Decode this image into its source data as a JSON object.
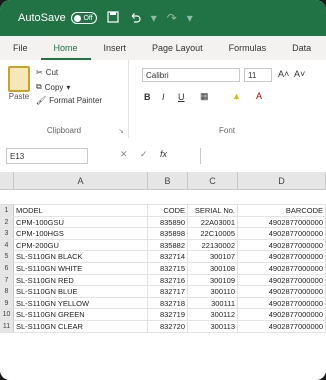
{
  "titlebar": {
    "autosave_label": "AutoSave",
    "autosave_state": "Off",
    "save_icon": "save-icon",
    "undo_icon": "undo-icon",
    "redo_icon": "redo-icon"
  },
  "tabs": [
    "File",
    "Home",
    "Insert",
    "Page Layout",
    "Formulas",
    "Data"
  ],
  "active_tab": "Home",
  "clipboard": {
    "paste_label": "Paste",
    "cut_label": "Cut",
    "copy_label": "Copy",
    "format_painter_label": "Format Painter",
    "group_label": "Clipboard"
  },
  "font": {
    "font_name": "Calibri",
    "font_size": "11",
    "group_label": "Font",
    "grow_label": "A˄",
    "shrink_label": "A˅",
    "bold": "B",
    "italic": "I",
    "underline": "U"
  },
  "formula": {
    "name_box": "E13",
    "fx_label": "fx"
  },
  "columns": [
    "A",
    "B",
    "C",
    "D"
  ],
  "rows": [
    {
      "n": "1",
      "model": "MODEL",
      "code": "CODE",
      "serial": "SERIAL No.",
      "barcode": "BARCODE"
    },
    {
      "n": "2",
      "model": "CPM-100GSU",
      "code": "835890",
      "serial": "22A03001",
      "barcode": "4902877000000"
    },
    {
      "n": "3",
      "model": "CPM-100HGS",
      "code": "835898",
      "serial": "22C10005",
      "barcode": "4902877000000"
    },
    {
      "n": "4",
      "model": "CPM-200GU",
      "code": "835882",
      "serial": "22130002",
      "barcode": "4902877000000"
    },
    {
      "n": "5",
      "model": "SL-S110GN BLACK",
      "code": "832714",
      "serial": "300107",
      "barcode": "4902877000000"
    },
    {
      "n": "6",
      "model": "SL-S110GN WHITE",
      "code": "832715",
      "serial": "300108",
      "barcode": "4902877000000"
    },
    {
      "n": "7",
      "model": "SL-S110GN RED",
      "code": "832716",
      "serial": "300109",
      "barcode": "4902877000000"
    },
    {
      "n": "8",
      "model": "SL-S110GN BLUE",
      "code": "832717",
      "serial": "300110",
      "barcode": "4902877000000"
    },
    {
      "n": "9",
      "model": "SL-S110GN YELLOW",
      "code": "832718",
      "serial": "300111",
      "barcode": "4902877000000"
    },
    {
      "n": "10",
      "model": "SL-S110GN GREEN",
      "code": "832719",
      "serial": "300112",
      "barcode": "4902877000000"
    },
    {
      "n": "11",
      "model": "SL-S110GN CLEAR",
      "code": "832720",
      "serial": "300113",
      "barcode": "4902877000000"
    }
  ],
  "colors": {
    "brand": "#217346"
  }
}
